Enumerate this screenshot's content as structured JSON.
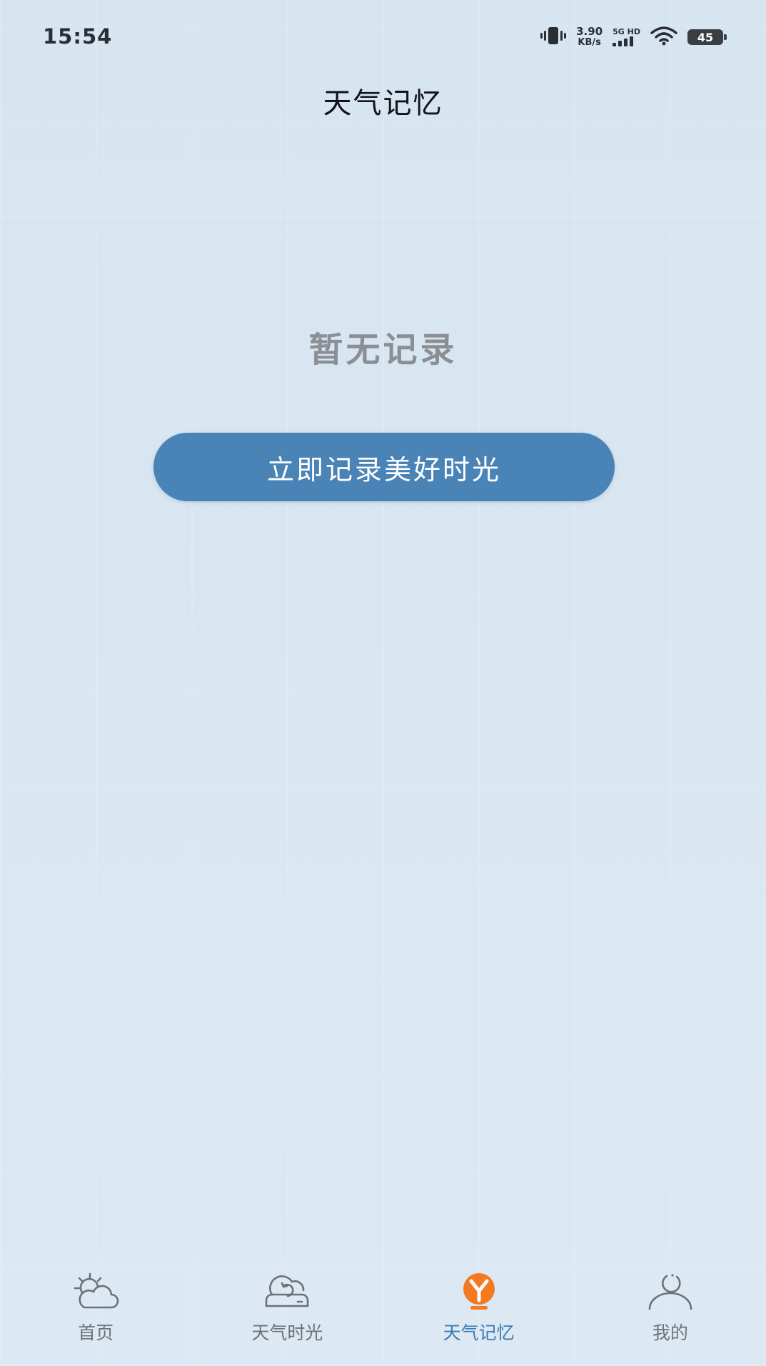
{
  "status_bar": {
    "time": "15:54",
    "speed_value": "3.90",
    "speed_unit": "KB/s",
    "network": "5G HD",
    "battery": "45"
  },
  "header": {
    "title": "天气记忆"
  },
  "empty_state": {
    "message": "暂无记录",
    "button_label": "立即记录美好时光"
  },
  "bottom_nav": {
    "items": [
      {
        "label": "首页",
        "icon": "sun-cloud-icon",
        "active": false
      },
      {
        "label": "天气时光",
        "icon": "weather-time-icon",
        "active": false
      },
      {
        "label": "天气记忆",
        "icon": "memory-icon",
        "active": true
      },
      {
        "label": "我的",
        "icon": "profile-icon",
        "active": false
      }
    ]
  },
  "colors": {
    "background": "#d8e6f1",
    "button": "#4a83b5",
    "active_nav": "#3c7ab2",
    "active_icon": "#f37a20",
    "inactive_nav": "#6d7178"
  }
}
